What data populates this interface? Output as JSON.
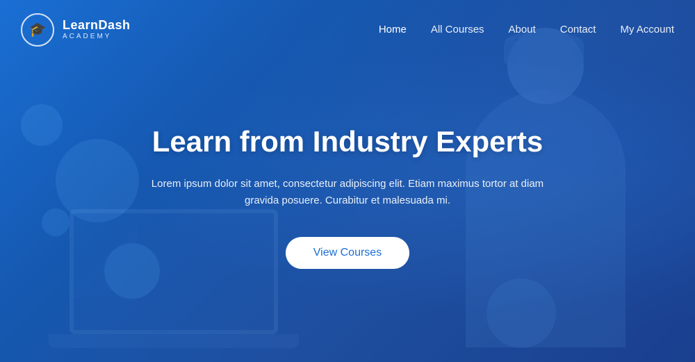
{
  "brand": {
    "logo_text": "LearnDash",
    "logo_sub": "ACADEMY",
    "logo_icon": "🎓"
  },
  "nav": {
    "items": [
      {
        "label": "Home",
        "active": true
      },
      {
        "label": "All Courses",
        "active": false
      },
      {
        "label": "About",
        "active": false
      },
      {
        "label": "Contact",
        "active": false
      },
      {
        "label": "My Account",
        "active": false
      }
    ]
  },
  "hero": {
    "title": "Learn from Industry Experts",
    "subtitle": "Lorem ipsum dolor sit amet, consectetur adipiscing elit. Etiam maximus tortor at diam gravida posuere. Curabitur et malesuada mi.",
    "cta_button": "View Courses"
  },
  "colors": {
    "bg_gradient_start": "#1a6fd4",
    "bg_gradient_end": "#1a3f8f",
    "text_white": "#ffffff",
    "btn_bg": "#ffffff",
    "btn_text": "#1a6fd4"
  }
}
